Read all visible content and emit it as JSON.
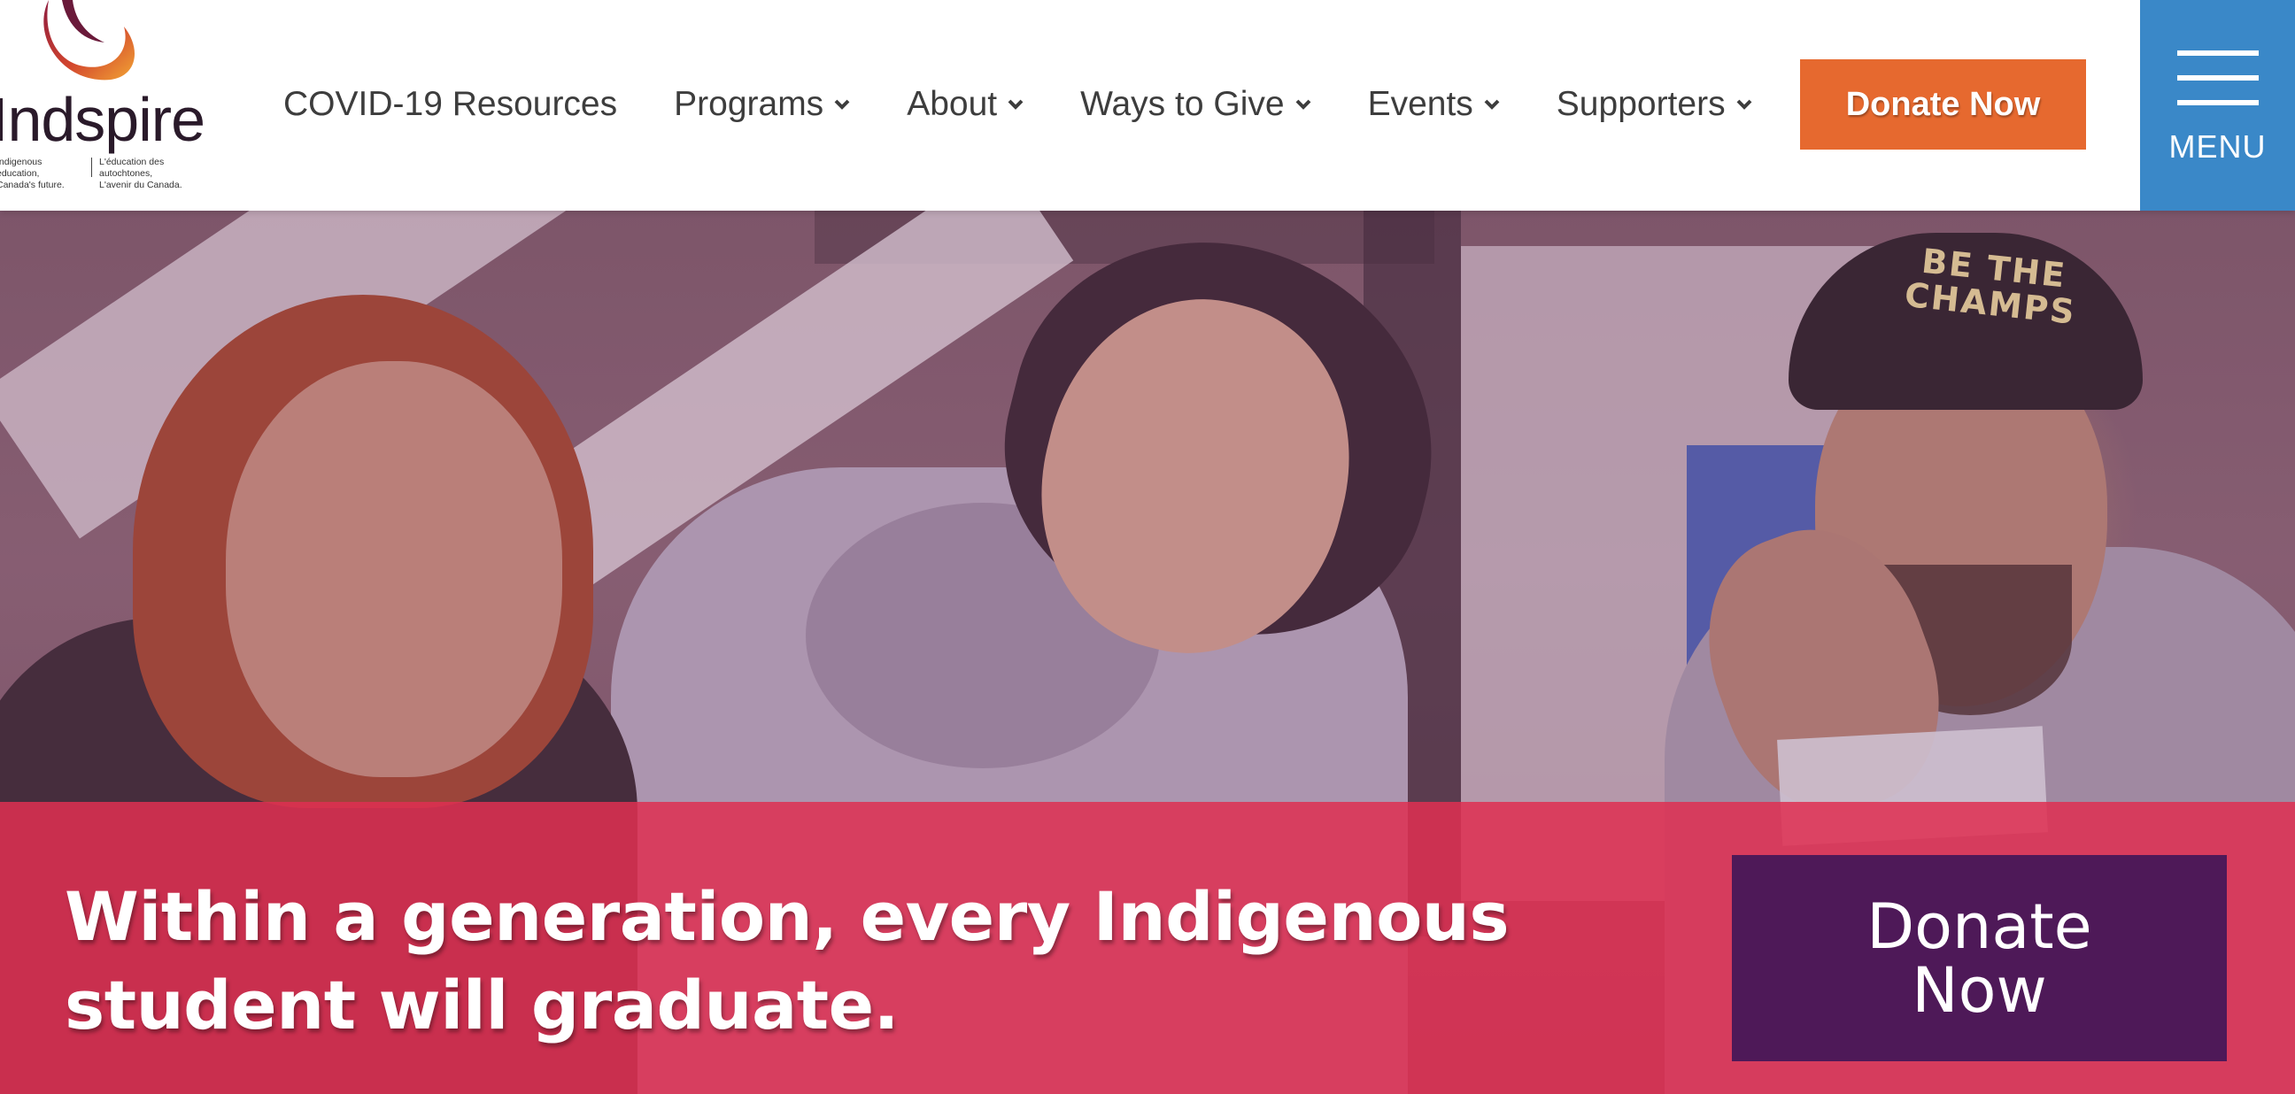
{
  "header": {
    "logo": {
      "wordmark": "Indspire",
      "tagline_en": "Indigenous education,\nCanada's future.",
      "tagline_fr": "L'éducation des autochtones,\nL'avenir du Canada."
    },
    "nav": {
      "items": [
        {
          "label": "COVID-19 Resources",
          "has_dropdown": false
        },
        {
          "label": "Programs",
          "has_dropdown": true
        },
        {
          "label": "About",
          "has_dropdown": true
        },
        {
          "label": "Ways to Give",
          "has_dropdown": true
        },
        {
          "label": "Events",
          "has_dropdown": true
        },
        {
          "label": "Supporters",
          "has_dropdown": true
        }
      ]
    },
    "donate_label": "Donate Now",
    "menu_label": "MENU"
  },
  "hero": {
    "cap_text": "BE THE\nCHAMPS",
    "tagline": "Within a generation, every Indigenous student will graduate.",
    "donate_label": "Donate Now"
  },
  "colors": {
    "donate_orange": "#e6692f",
    "menu_blue": "#3a88c8",
    "banner_red": "#de3052",
    "donate_purple": "#4e1958",
    "nav_text": "#3d3d3d"
  }
}
